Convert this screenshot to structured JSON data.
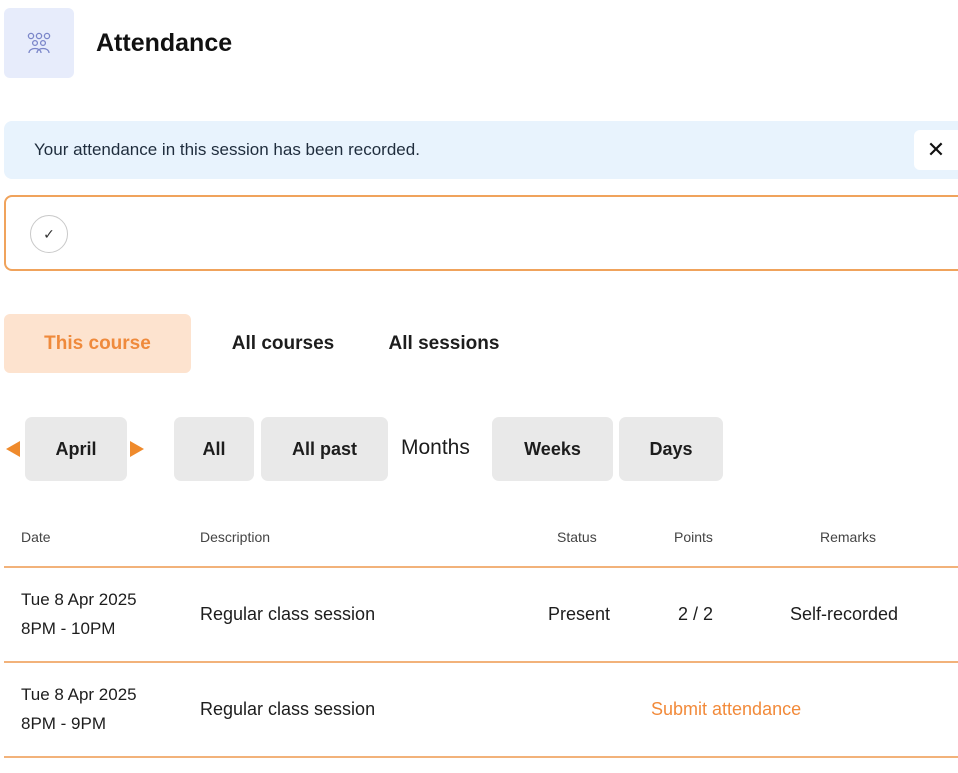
{
  "header": {
    "title": "Attendance",
    "icon": "group-icon"
  },
  "alert": {
    "message": "Your attendance in this session has been recorded.",
    "close_symbol": "✕"
  },
  "status_check": {
    "symbol": "✓"
  },
  "tabs": [
    {
      "label": "This course",
      "active": true
    },
    {
      "label": "All courses",
      "active": false
    },
    {
      "label": "All sessions",
      "active": false
    }
  ],
  "filters": {
    "month": "April",
    "all_label": "All",
    "all_past_label": "All past",
    "months_label": "Months",
    "weeks_label": "Weeks",
    "days_label": "Days"
  },
  "table": {
    "columns": [
      "Date",
      "Description",
      "Status",
      "Points",
      "Remarks"
    ],
    "rows": [
      {
        "date": "Tue 8 Apr 2025",
        "time": "8PM - 10PM",
        "description": "Regular class session",
        "status": "Present",
        "points": "2 / 2",
        "remarks": "Self-recorded"
      },
      {
        "date": "Tue 8 Apr 2025",
        "time": "8PM - 9PM",
        "description": "Regular class session",
        "action": "Submit attendance"
      }
    ]
  },
  "colors": {
    "accent": "#ef8a3c",
    "tab_active_bg": "#fde3cf",
    "alert_bg": "#e8f3fd",
    "divider": "#f2b27a",
    "filter_bg": "#e9e9e9"
  }
}
